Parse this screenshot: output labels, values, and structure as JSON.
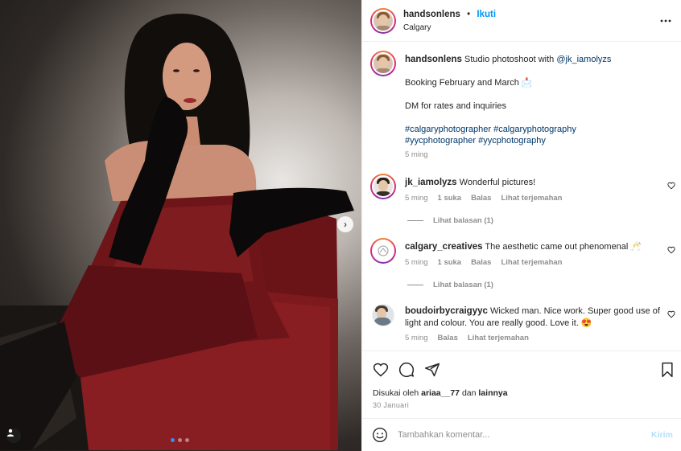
{
  "post": {
    "author": "handsonlens",
    "follow_label": "Ikuti",
    "separator": "•",
    "location": "Calgary",
    "more_label": "•••"
  },
  "caption": {
    "author": "handsonlens",
    "text_1": "Studio photoshoot with",
    "mention": "@jk_iamolyzs",
    "line_2": "Booking February and March 📩",
    "line_3": "DM for rates and inquiries",
    "hashtags_1": "#calgaryphotographer #calgaryphotography",
    "hashtags_2": "#yycphotographer #yycphotography",
    "time": "5 ming"
  },
  "comments": [
    {
      "author": "jk_iamolyzs",
      "text": "Wonderful pictures!",
      "time": "5 ming",
      "likes": "1 suka",
      "reply": "Balas",
      "translate": "Lihat terjemahan",
      "view_replies": "Lihat balasan (1)"
    },
    {
      "author": "calgary_creatives",
      "text": "The aesthetic came out phenomenal 🥂",
      "time": "5 ming",
      "likes": "1 suka",
      "reply": "Balas",
      "translate": "Lihat terjemahan",
      "view_replies": "Lihat balasan (1)"
    },
    {
      "author": "boudoirbycraigyyc",
      "text": "Wicked man. Nice work. Super good use of light and colour. You are really good. Love it. 😍",
      "time": "5 ming",
      "reply": "Balas",
      "translate": "Lihat terjemahan"
    }
  ],
  "actions": {
    "liked_by_prefix": "Disukai oleh",
    "liked_by_user": "ariaa__77",
    "liked_by_conj": "dan",
    "liked_by_others": "lainnya",
    "date": "30 Januari"
  },
  "composer": {
    "placeholder": "Tambahkan komentar...",
    "post_label": "Kirim"
  },
  "carousel": {
    "next_label": "›",
    "slide_count": 3,
    "current_slide": 1
  },
  "colors": {
    "accent": "#0095f6",
    "link": "#00376b",
    "muted": "#8e8e8e",
    "post_disabled": "#b2dffc",
    "dress": "#7a1d21"
  }
}
